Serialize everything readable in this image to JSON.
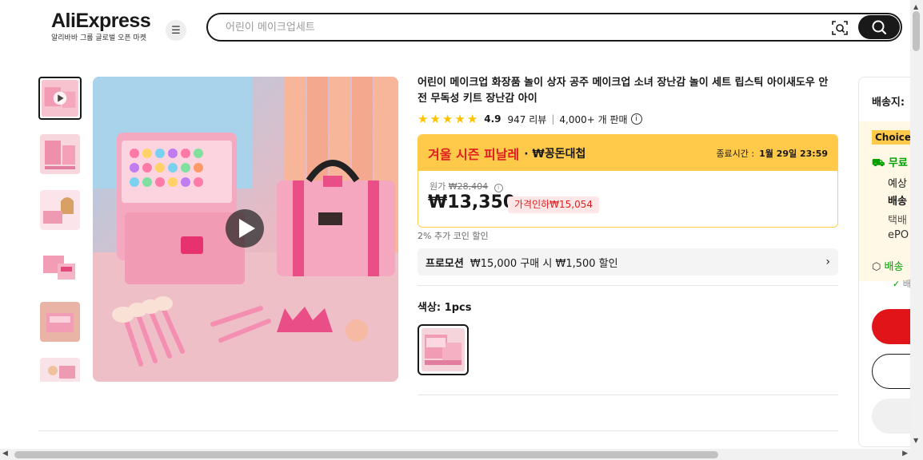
{
  "header": {
    "logo_text": "AliExpress",
    "tagline": "알리바바 그룹 글로벌 오픈 마켓",
    "search_placeholder": "어린이 메이크업세트"
  },
  "product": {
    "title": "어린이 메이크업 화장품 놀이 상자 공주 메이크업 소녀 장난감 놀이 세트 립스틱 아이새도우 안전 무독성 키트 장난감 아이",
    "rating": "4.9",
    "reviews": "947 리뷰",
    "sold": "4,000+ 개 판매",
    "star_count": 5
  },
  "deal": {
    "title": "겨울 시즌 피날레",
    "subtitle": "· ₩꽁돈대첩",
    "end_label": "종료시간 :",
    "end_time": "1월 29일 23:59",
    "original_label": "원가",
    "original_price": "₩28,404",
    "price": "₩13,350",
    "discount": "가격인하₩15,054"
  },
  "coin_text": "2% 추가 코인 할인",
  "promotion": {
    "label": "프로모션",
    "text": "₩15,000 구매 시 ₩1,500 할인"
  },
  "color": {
    "label": "색상: 1pcs"
  },
  "shipping": {
    "label": "배송지:",
    "choice": "Choice",
    "free": "무료",
    "est1": "예상",
    "est2": "배송",
    "courier": "택배",
    "epo": "ePO",
    "safe": "배송",
    "safe_sub": "배"
  },
  "colors": {
    "accent_red": "#e1141a",
    "deal_yellow": "#ffc94a",
    "star": "#ffc300",
    "free_green": "#00a000"
  }
}
